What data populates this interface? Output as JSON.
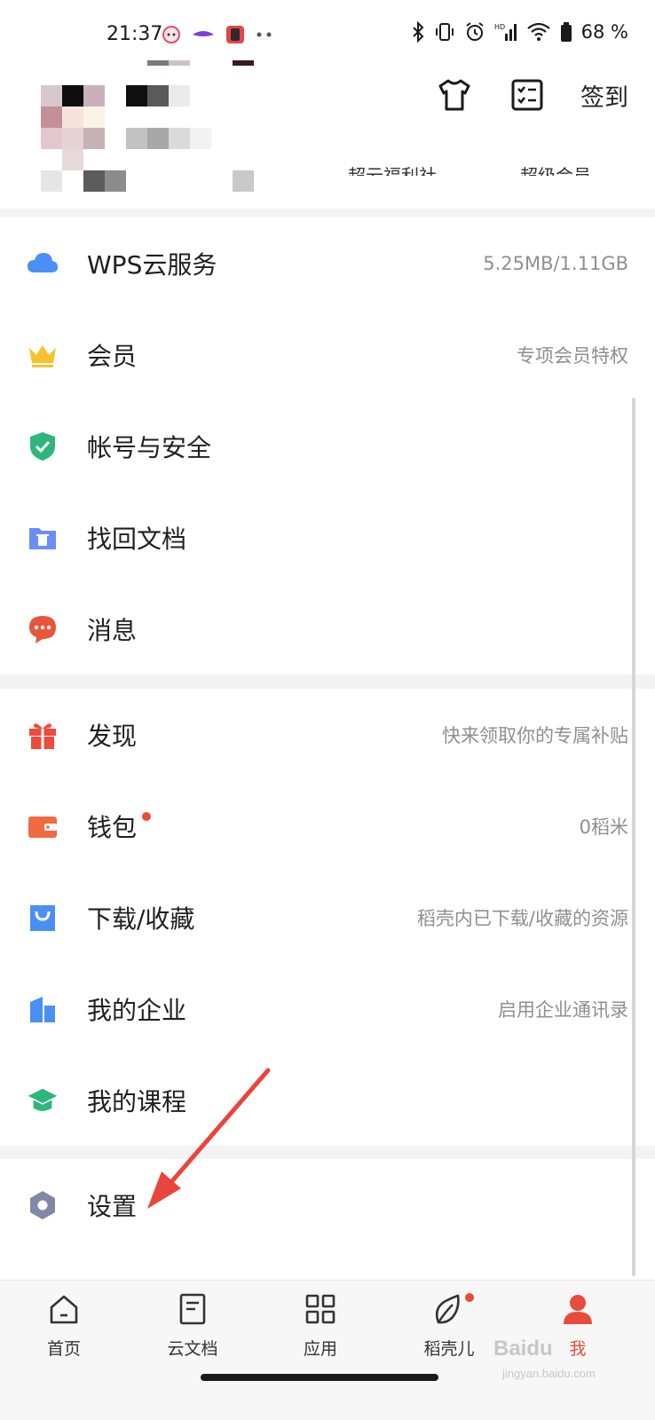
{
  "status_bar": {
    "time": "21:37",
    "battery": "68 %"
  },
  "header": {
    "checkin_label": "签到",
    "sub_left": "超云福利社",
    "sub_right": "超级会员"
  },
  "menu_group_1": [
    {
      "label": "WPS云服务",
      "value": "5.25MB/1.11GB",
      "icon": "cloud-icon",
      "color": "#4a8ff5"
    },
    {
      "label": "会员",
      "value": "专项会员特权",
      "icon": "crown-icon",
      "color": "#f6c12a"
    },
    {
      "label": "帐号与安全",
      "value": "",
      "icon": "shield-icon",
      "color": "#2fb67c"
    },
    {
      "label": "找回文档",
      "value": "",
      "icon": "trash-folder-icon",
      "color": "#6b8ef6"
    },
    {
      "label": "消息",
      "value": "",
      "icon": "message-bubble-icon",
      "color": "#e9553b"
    }
  ],
  "menu_group_2": [
    {
      "label": "发现",
      "value": "快来领取你的专属补贴",
      "icon": "gift-icon",
      "color": "#ef4a3b"
    },
    {
      "label": "钱包",
      "value": "0稻米",
      "icon": "wallet-icon",
      "color": "#f06a42"
    },
    {
      "label": "下载/收藏",
      "value": "稻壳内已下载/收藏的资源",
      "icon": "shopping-bag-icon",
      "color": "#4a8ff5"
    },
    {
      "label": "我的企业",
      "value": "启用企业通讯录",
      "icon": "building-icon",
      "color": "#4a8ff5"
    },
    {
      "label": "我的课程",
      "value": "",
      "icon": "graduation-cap-icon",
      "color": "#2fb67c"
    }
  ],
  "menu_group_3": [
    {
      "label": "设置",
      "value": "",
      "icon": "gear-hexagon-icon",
      "color": "#7e89a6"
    }
  ],
  "bottom_nav": [
    {
      "label": "首页",
      "icon": "home-icon"
    },
    {
      "label": "云文档",
      "icon": "document-icon"
    },
    {
      "label": "应用",
      "icon": "grid-icon"
    },
    {
      "label": "稻壳儿",
      "icon": "leaf-icon"
    },
    {
      "label": "我",
      "icon": "person-icon"
    }
  ],
  "watermark": {
    "brand": "Baidu",
    "sub": "jingyan.baidu.com"
  },
  "colors": {
    "accent_red": "#e74c3c",
    "text_secondary": "#8f8f8f",
    "divider": "#f3f3f3"
  }
}
